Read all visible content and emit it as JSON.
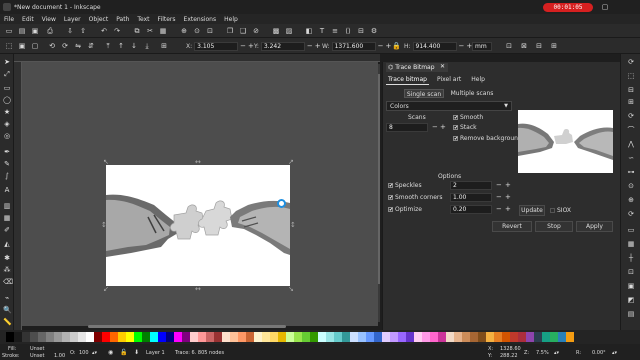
{
  "window": {
    "title": "*New document 1 - Inkscape",
    "recording_time": "00:01:05"
  },
  "menu": [
    "File",
    "Edit",
    "View",
    "Layer",
    "Object",
    "Path",
    "Text",
    "Filters",
    "Extensions",
    "Help"
  ],
  "toolbar": {
    "x_label": "X:",
    "x_value": "3.105",
    "y_label": "Y:",
    "y_value": "3.242",
    "w_label": "W:",
    "w_value": "1371.600",
    "h_label": "H:",
    "h_value": "914.400",
    "unit": "mm"
  },
  "dock": {
    "tab_title": "Trace Bitmap",
    "subtabs": [
      "Trace bitmap",
      "Pixel art",
      "Help"
    ],
    "scan_modes": [
      "Single scan",
      "Multiple scans"
    ],
    "mode": "Colors",
    "scans_label": "Scans",
    "scans_value": "8",
    "check_smooth": "Smooth",
    "check_stack": "Stack",
    "check_remove_bg": "Remove background",
    "options_label": "Options",
    "speckles_label": "Speckles",
    "speckles_value": "2",
    "smooth_corners_label": "Smooth corners",
    "smooth_corners_value": "1.00",
    "optimize_label": "Optimize",
    "optimize_value": "0.20",
    "update_label": "Update",
    "siox_label": "SIOX",
    "revert_label": "Revert",
    "stop_label": "Stop",
    "apply_label": "Apply"
  },
  "status": {
    "fill_label": "Fill:",
    "fill_value": "Unset",
    "stroke_label": "Stroke:",
    "stroke_value": "Unset",
    "stroke_width": "1.00",
    "opacity_label": "O:",
    "opacity_value": "100",
    "layer": "Layer 1",
    "message": "Trace: 6.  805 nodes",
    "x_label": "X:",
    "x_value": "1328.60",
    "y_label": "Y:",
    "y_value": "288.22",
    "zoom_label": "Z:",
    "zoom_value": "7.5%",
    "rotation_label": "R:",
    "rotation_value": "0.00°"
  },
  "palette": [
    "#000000",
    "#1a1a1a",
    "#333333",
    "#4d4d4d",
    "#666666",
    "#808080",
    "#999999",
    "#b3b3b3",
    "#cccccc",
    "#e6e6e6",
    "#ffffff",
    "#800000",
    "#ff0000",
    "#ff6600",
    "#ffcc00",
    "#ffff00",
    "#00ff00",
    "#008000",
    "#00ffff",
    "#0000ff",
    "#000080",
    "#ff00ff",
    "#800080",
    "#ffcccc",
    "#ff9999",
    "#cc6666",
    "#993333",
    "#ffe0cc",
    "#ffc299",
    "#ff9966",
    "#cc6633",
    "#fff2cc",
    "#ffe699",
    "#ffd966",
    "#e6b800",
    "#ccff99",
    "#99e64d",
    "#66cc33",
    "#339900",
    "#ccffff",
    "#99e6e6",
    "#66cccc",
    "#339999",
    "#cce0ff",
    "#99c2ff",
    "#6699ff",
    "#3366cc",
    "#e0ccff",
    "#c299ff",
    "#9966ff",
    "#6633cc",
    "#ffccf2",
    "#ff99e6",
    "#ff66cc",
    "#cc3399",
    "#f2d9c6",
    "#e6b38c",
    "#cc8c59",
    "#a66633",
    "#804d1a",
    "#f5b041",
    "#e67e22",
    "#d35400",
    "#c0392b",
    "#ab2e3c",
    "#8e44ad",
    "#2c3e50",
    "#16a085",
    "#27ae60",
    "#2980b9",
    "#f39c12"
  ]
}
